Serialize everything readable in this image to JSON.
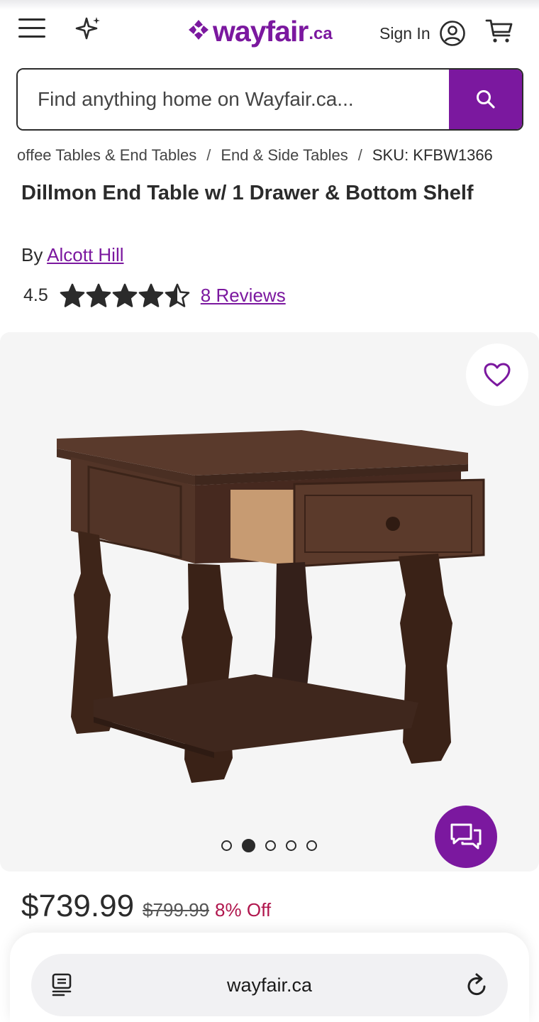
{
  "header": {
    "logo_word": "wayfair",
    "logo_tld": ".ca",
    "sign_in_label": "Sign In",
    "icons": [
      "menu-icon",
      "sparkle-icon",
      "user-icon",
      "cart-icon"
    ]
  },
  "search": {
    "placeholder": "Find anything home on Wayfair.ca...",
    "value": ""
  },
  "breadcrumb": {
    "items": [
      "offee Tables & End Tables",
      "End & Side Tables"
    ],
    "separator": "/",
    "sku": "SKU: KFBW1366"
  },
  "product": {
    "title": "Dillmon End Table w/ 1 Drawer & Bottom Shelf",
    "by_label": "By",
    "brand": "Alcott Hill",
    "rating": "4.5",
    "stars": 4.5,
    "reviews_label": "8 Reviews"
  },
  "gallery": {
    "image_count": 5,
    "active_index": 1
  },
  "pricing": {
    "price": "$739.99",
    "was_price": "$799.99",
    "discount": "8% Off"
  },
  "browser": {
    "url": "wayfair.ca"
  },
  "colors": {
    "brand": "#7b189f",
    "discount": "#b0164d",
    "gallery_bg": "#f5f5f5"
  }
}
